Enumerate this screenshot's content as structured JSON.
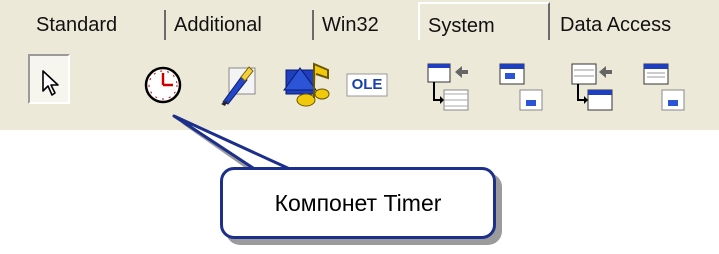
{
  "tabs": [
    {
      "label": "Standard",
      "active": false
    },
    {
      "label": "Additional",
      "active": false
    },
    {
      "label": "Win32",
      "active": false
    },
    {
      "label": "System",
      "active": true
    },
    {
      "label": "Data Access",
      "active": false
    }
  ],
  "palette": {
    "items": [
      {
        "icon": "arrow-cursor-icon",
        "selected": true
      },
      {
        "icon": "timer-clock-icon"
      },
      {
        "icon": "paintbox-icon"
      },
      {
        "icon": "mediaplayer-icon"
      },
      {
        "icon": "olecontainer-icon",
        "text": "OLE"
      },
      {
        "icon": "ddeclientconv-icon"
      },
      {
        "icon": "ddeclientitem-icon"
      },
      {
        "icon": "ddeserverconv-icon"
      },
      {
        "icon": "ddeserveritem-icon"
      }
    ]
  },
  "callout": {
    "text": "Компонет Timer"
  },
  "colors": {
    "panel": "#ece9d8",
    "callout_border": "#1c2f8a",
    "ole_blue": "#1a3fb0"
  }
}
